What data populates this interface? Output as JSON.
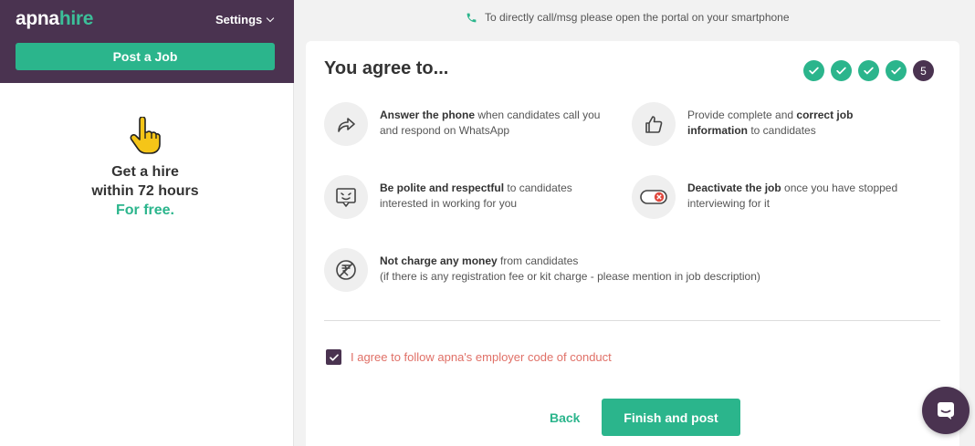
{
  "brand": {
    "part1": "apna",
    "part2": "hire"
  },
  "header": {
    "settings_label": "Settings",
    "post_job_label": "Post a Job"
  },
  "promo": {
    "line1": "Get a hire",
    "line2": "within 72 hours",
    "line3": "For free."
  },
  "notice": "To directly call/msg please open the portal on your smartphone",
  "card": {
    "title": "You agree to...",
    "current_step": "5",
    "rules": [
      {
        "bold": "Answer the phone",
        "rest": " when candidates call you and respond on WhatsApp",
        "icon": "phone-forward-icon"
      },
      {
        "pre": "Provide complete and ",
        "bold": "correct job information",
        "rest": " to candidates",
        "icon": "thumbs-up-icon"
      },
      {
        "bold": "Be polite and respectful",
        "rest": " to candidates interested in working for you",
        "icon": "smiley-message-icon"
      },
      {
        "bold": "Deactivate the job",
        "rest": " once you have stopped interviewing for it",
        "icon": "toggle-off-icon"
      },
      {
        "bold": "Not charge any money",
        "rest": " from candidates",
        "line2": "(if there is any registration fee or kit charge - please mention in job description)",
        "icon": "no-rupee-icon"
      }
    ],
    "agree_label": "I agree to follow apna's employer code of conduct",
    "back_label": "Back",
    "finish_label": "Finish and post"
  },
  "colors": {
    "brand_purple": "#4a3350",
    "brand_green": "#2bb58c",
    "agree_red": "#e07067"
  }
}
